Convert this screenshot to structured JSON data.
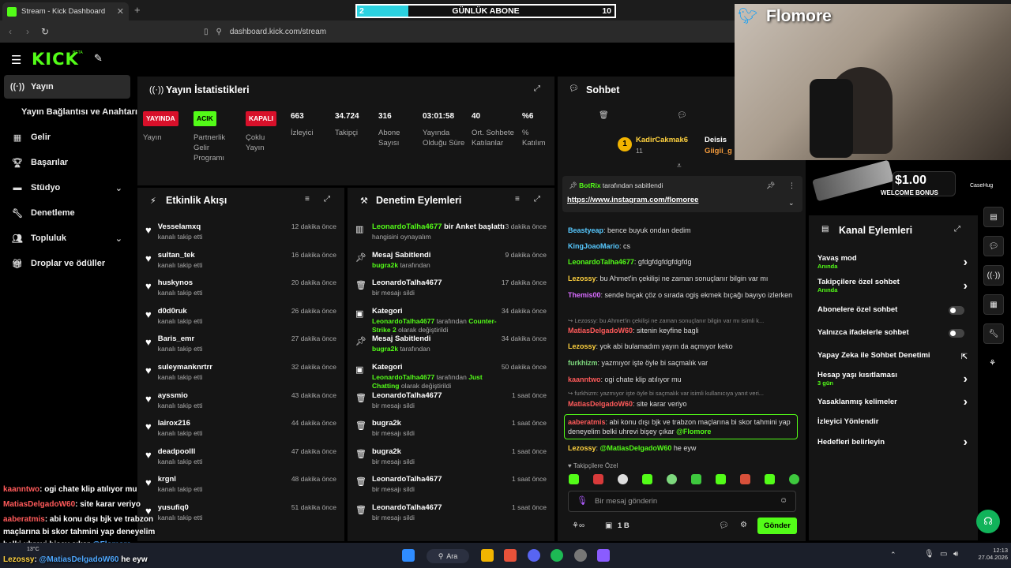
{
  "browser": {
    "tab_title": "Stream - Kick Dashboard",
    "url": "dashboard.kick.com/stream"
  },
  "goal": {
    "current": "2",
    "label": "GÜNLÜK ABONE",
    "target": "10",
    "progress": 0.2
  },
  "brand": {
    "logo": "KICK",
    "beta": "BETA",
    "accent": "#53fc18"
  },
  "sidebar": {
    "items": [
      {
        "label": "Yayın",
        "icon": "broadcast-icon"
      },
      {
        "label": "Yayın Bağlantısı ve Anahtarı"
      },
      {
        "label": "Gelir",
        "icon": "revenue-icon"
      },
      {
        "label": "Başarılar",
        "icon": "trophy-icon"
      },
      {
        "label": "Stüdyo",
        "icon": "studio-icon"
      },
      {
        "label": "Denetleme",
        "icon": "wrench-icon"
      },
      {
        "label": "Topluluk",
        "icon": "community-icon"
      },
      {
        "label": "Droplar ve ödüller",
        "icon": "gift-icon"
      }
    ]
  },
  "stats": {
    "title": "Yayın İstatistikleri",
    "badges": [
      {
        "text": "YAYINDA",
        "label": "Yayın"
      },
      {
        "text": "ACIK",
        "label": "Partnerlik Gelir Programı"
      },
      {
        "text": "KAPALI",
        "label": "Çoklu Yayın"
      }
    ],
    "values": [
      {
        "v": "663",
        "l": "İzleyici"
      },
      {
        "v": "34.724",
        "l": "Takipçi"
      },
      {
        "v": "316",
        "l": "Abone Sayısı"
      },
      {
        "v": "03:01:58",
        "l": "Yayında Olduğu Süre"
      },
      {
        "v": "40",
        "l": "Ort. Sohbete Katılanlar"
      },
      {
        "v": "%6",
        "l": "% Katılım"
      }
    ]
  },
  "activity": {
    "title": "Etkinlik Akışı",
    "items": [
      {
        "name": "Vesselamxq",
        "sub": "kanalı takip etti",
        "time": "12 dakika önce"
      },
      {
        "name": "sultan_tek",
        "sub": "kanalı takip etti",
        "time": "16 dakika önce"
      },
      {
        "name": "huskynos",
        "sub": "kanalı takip etti",
        "time": "20 dakika önce"
      },
      {
        "name": "d0d0ruk",
        "sub": "kanalı takip etti",
        "time": "26 dakika önce"
      },
      {
        "name": "Baris_emr",
        "sub": "kanalı takip etti",
        "time": "27 dakika önce"
      },
      {
        "name": "suleymanknrtrr",
        "sub": "kanalı takip etti",
        "time": "32 dakika önce"
      },
      {
        "name": "ayssmio",
        "sub": "kanalı takip etti",
        "time": "43 dakika önce"
      },
      {
        "name": "lairox216",
        "sub": "kanalı takip etti",
        "time": "44 dakika önce"
      },
      {
        "name": "deadpoolll",
        "sub": "kanalı takip etti",
        "time": "47 dakika önce"
      },
      {
        "name": "krgnl",
        "sub": "kanalı takip etti",
        "time": "48 dakika önce"
      },
      {
        "name": "yusufiq0",
        "sub": "kanalı takip etti",
        "time": "51 dakika önce"
      }
    ]
  },
  "moderation": {
    "title": "Denetim Eylemleri",
    "items": [
      {
        "title": "LeonardoTalha4677",
        "title2": " bir Anket başlattı",
        "sub": "hangisini oynayalım",
        "time": "3 dakika önce",
        "icon": "poll-icon"
      },
      {
        "title": "Mesaj Sabitlendi",
        "sub_g": "bugra2k",
        "sub": " tarafından",
        "time": "9 dakika önce",
        "icon": "pin-icon"
      },
      {
        "title": "LeonardoTalha4677",
        "sub": "bir mesajı sildi",
        "time": "17 dakika önce",
        "icon": "trash-icon"
      },
      {
        "title": "Kategori",
        "sub_g": "LeonardoTalha4677",
        "sub": " tarafından ",
        "sub_g2": "Counter-Strike 2",
        "sub2": " olarak değiştirildi",
        "time": "34 dakika önce",
        "icon": "category-icon"
      },
      {
        "title": "Mesaj Sabitlendi",
        "sub_g": "bugra2k",
        "sub": " tarafından",
        "time": "34 dakika önce",
        "icon": "pin-icon"
      },
      {
        "title": "Kategori",
        "sub_g": "LeonardoTalha4677",
        "sub": " tarafından ",
        "sub_g2": "Just Chatting",
        "sub2": " olarak değiştirildi",
        "time": "50 dakika önce",
        "icon": "category-icon"
      },
      {
        "title": "LeonardoTalha4677",
        "sub": "bir mesajı sildi",
        "time": "1 saat önce",
        "icon": "trash-icon"
      },
      {
        "title": "bugra2k",
        "sub": "bir mesajı sildi",
        "time": "1 saat önce",
        "icon": "trash-icon"
      },
      {
        "title": "bugra2k",
        "sub": "bir mesajı sildi",
        "time": "1 saat önce",
        "icon": "trash-icon"
      },
      {
        "title": "LeonardoTalha4677",
        "sub": "bir mesajı sildi",
        "time": "1 saat önce",
        "icon": "trash-icon"
      },
      {
        "title": "LeonardoTalha4677",
        "sub": "bir mesajı sildi",
        "time": "1 saat önce",
        "icon": "trash-icon"
      }
    ]
  },
  "chat": {
    "title": "Sohbet",
    "top_gifters": [
      {
        "name": "KadirCakmak6",
        "count": "11"
      },
      {
        "name": "Deisis"
      },
      {
        "name": "Giigii_g"
      }
    ],
    "pinned": {
      "by": "BotRix",
      "by_suffix": " tarafından sabitlendi",
      "link": "https://www.instagram.com/flomoree"
    },
    "messages": [
      {
        "user": "Beastyeap",
        "color": "#57c9ff",
        "text": "bence buyuk ondan dedim"
      },
      {
        "user": "KingJoaoMario",
        "color": "#57c9ff",
        "text": "cs"
      },
      {
        "user": "LeonardoTalha4677",
        "color": "#53fc18",
        "text": "gfdgfdgfdgfdgfdg"
      },
      {
        "user": "Lezossy",
        "color": "#ffd23f",
        "text": "bu Ahmet'in çekilişi ne zaman sonuçlanır bilgin var mı"
      },
      {
        "user": "Themis00",
        "color": "#d86bff",
        "text": "sende bıçak çöz o sırada ogiş ekmek bıçağı bayıyo izlerken"
      },
      {
        "reply": "↪ Lezossy: bu Ahmet'in çekilişi ne zaman sonuçlanır bilgin var mı isimli k..."
      },
      {
        "user": "MatiasDelgadoW60",
        "color": "#ff5a5a",
        "text": "sitenin keyfine bagli"
      },
      {
        "user": "Lezossy",
        "color": "#ffd23f",
        "text": "yok abi bulamadım yayın da açmıyor keko"
      },
      {
        "user": "furkhizm",
        "color": "#7dd87d",
        "text": "yazmıyor işte öyle bi saçmalık var"
      },
      {
        "user": "kaanntwo",
        "color": "#ff5a5a",
        "text": "ogi chate klip atılıyor mu"
      },
      {
        "reply": "↪ furkhizm: yazmıyor işte öyle bi saçmalık var isimli kullanıcıya yanıt veri..."
      },
      {
        "user": "MatiasDelgadoW60",
        "color": "#ff5a5a",
        "text": "site karar veriyo"
      },
      {
        "user": "aaberatmis",
        "color": "#ff5a5a",
        "text": "abi konu dışı bjk ve trabzon maçlarına bi skor tahmini yap deneyelim belki uhrevi bişey çıkar",
        "mention": "@Flomore",
        "highlight": true
      },
      {
        "user": "Lezossy",
        "color": "#ffd23f",
        "text": " he eyw",
        "mention": "@MatiasDelgadoW60"
      }
    ],
    "followers_only": "Takipçilere Özel",
    "input_placeholder": "Bir mesaj gönderin",
    "points": "1 B",
    "send": "Gönder"
  },
  "overlay": {
    "twitter_name": "Flomore",
    "bonus": "$1.00",
    "bonus_sub": "WELCOME BONUS",
    "casino": "CaseHug",
    "chat": [
      {
        "user": "kaanntwo",
        "text": ": ogi chate klip atılıyor mu"
      },
      {
        "user": "MatiasDelgadoW60",
        "text": ": site karar veriyo"
      },
      {
        "user": "aaberatmis",
        "text": ": abi konu dışı bjk ve trabzon",
        "text2": "maçlarına bi skor tahmini yap deneyelim",
        "text3": "belki uhrevi bişey çıkar ",
        "mention": "@Flomore"
      },
      {
        "user": "Lezossy",
        "text": ": ",
        "mention": "@MatiasDelgadoW60",
        "text2": " he eyw"
      }
    ]
  },
  "channel_actions": {
    "title": "Kanal Eylemleri",
    "items": [
      {
        "label": "Yavaş mod",
        "sub": "Anında",
        "type": "arrow"
      },
      {
        "label": "Takipçilere özel sohbet",
        "sub": "Anında",
        "type": "arrow"
      },
      {
        "label": "Abonelere özel sohbet",
        "type": "toggle"
      },
      {
        "label": "Yalnızca ifadelerle sohbet",
        "type": "toggle"
      },
      {
        "label": "Yapay Zeka ile Sohbet Denetimi",
        "type": "external"
      },
      {
        "label": "Hesap yaşı kısıtlaması",
        "sub": "3 gün",
        "type": "arrow"
      },
      {
        "label": "Yasaklanmış kelimeler",
        "type": "arrow"
      },
      {
        "label": "İzleyici Yönlendir",
        "type": "none"
      },
      {
        "label": "Hedefleri belirleyin",
        "type": "arrow"
      }
    ]
  },
  "taskbar": {
    "search": "Ara",
    "temp": "13°C",
    "time": "12:13",
    "date": "27.04.2026"
  }
}
